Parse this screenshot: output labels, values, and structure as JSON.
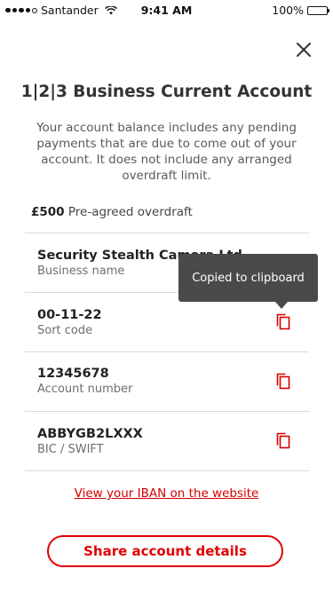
{
  "status_bar": {
    "carrier": "Santander",
    "time": "9:41 AM",
    "battery": "100%"
  },
  "icons": {
    "close": "close-icon",
    "copy": "copy-icon",
    "wifi": "wifi-icon",
    "battery": "battery-icon"
  },
  "colors": {
    "accent": "#e10000",
    "tooltip_bg": "#4a4a4a"
  },
  "header": {
    "title": "1|2|3 Business Current Account",
    "description": "Your account balance includes any pending payments that are due to come out of your account. It does not include any arranged overdraft limit."
  },
  "overdraft": {
    "amount": "£500",
    "label": "Pre-agreed overdraft"
  },
  "details": [
    {
      "value": "Security Stealth Camera Ltd",
      "label": "Business name"
    },
    {
      "value": "00-11-22",
      "label": "Sort code"
    },
    {
      "value": "12345678",
      "label": "Account number"
    },
    {
      "value": "ABBYGB2LXXX",
      "label": "BIC / SWIFT"
    }
  ],
  "tooltip": {
    "text": "Copied to clipboard"
  },
  "actions": {
    "iban_link": "View your IBAN on the website",
    "share_button": "Share account details"
  }
}
